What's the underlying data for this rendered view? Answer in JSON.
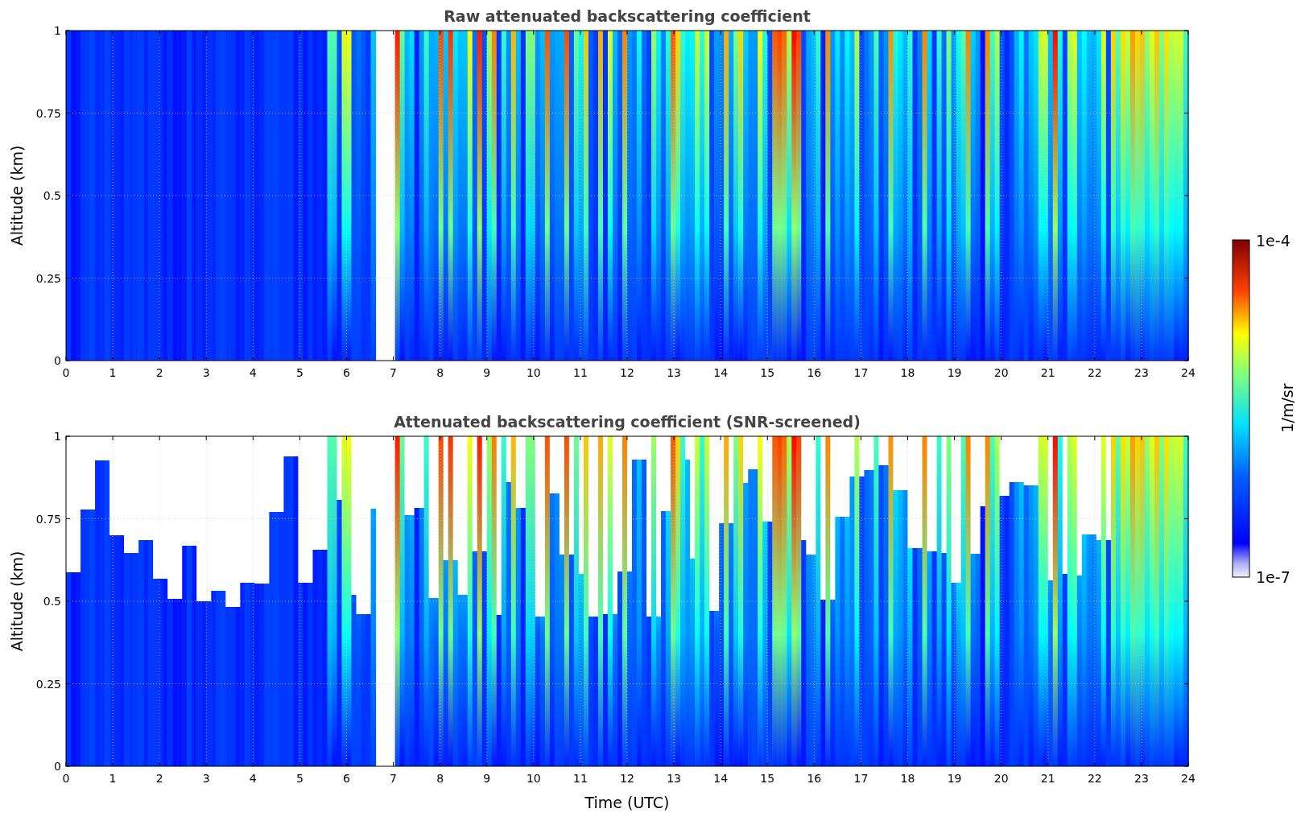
{
  "panels": [
    {
      "title": "Raw attenuated backscattering coefficient",
      "ylabel": "Altitude (km)",
      "yticks": [
        "1",
        "0.75",
        "0.5",
        "0.25",
        "0"
      ],
      "xticks": [
        "0",
        "1",
        "2",
        "3",
        "4",
        "5",
        "6",
        "7",
        "8",
        "9",
        "10",
        "11",
        "12",
        "13",
        "14",
        "15",
        "16",
        "17",
        "18",
        "19",
        "20",
        "21",
        "22",
        "23",
        "24"
      ],
      "screened": false
    },
    {
      "title": "Attenuated backscattering coefficient (SNR-screened)",
      "ylabel": "Altitude (km)",
      "yticks": [
        "1",
        "0.75",
        "0.5",
        "0.25",
        "0"
      ],
      "xticks": [
        "0",
        "1",
        "2",
        "3",
        "4",
        "5",
        "6",
        "7",
        "8",
        "9",
        "10",
        "11",
        "12",
        "13",
        "14",
        "15",
        "16",
        "17",
        "18",
        "19",
        "20",
        "21",
        "22",
        "23",
        "24"
      ],
      "screened": true
    }
  ],
  "xlabel": "Time (UTC)",
  "colorbar": {
    "label": "1/m/sr",
    "max": "1e-4",
    "min": "1e-7"
  }
}
